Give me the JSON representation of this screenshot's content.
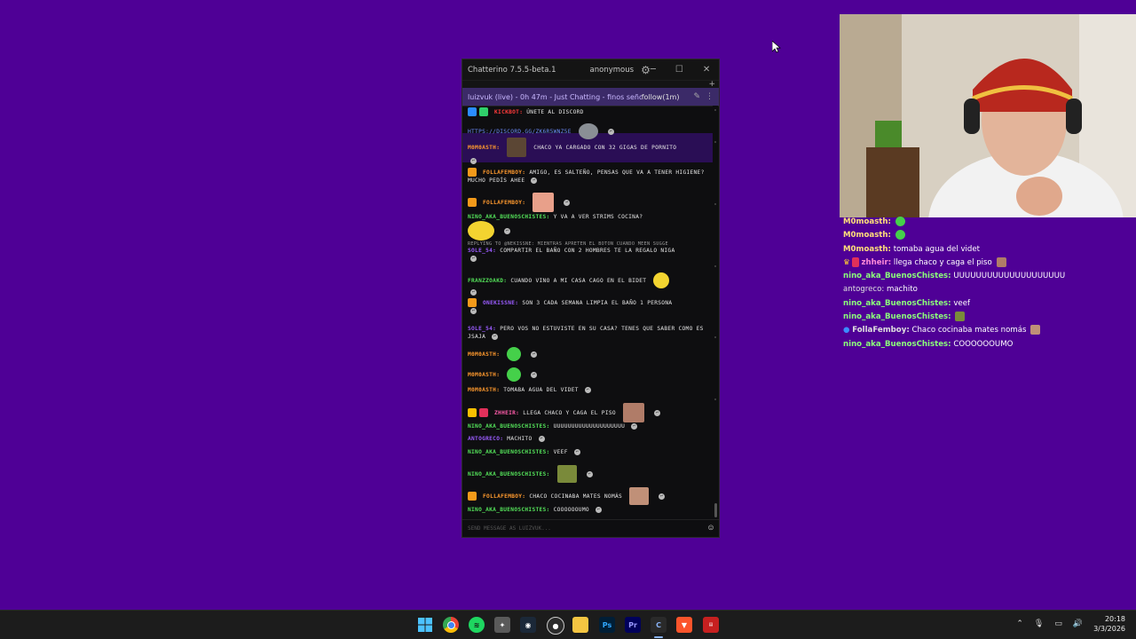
{
  "window": {
    "title": "Chatterino 7.5.5-beta.1",
    "account": "anonymous",
    "minimize": "─",
    "maximize": "☐",
    "close": "✕"
  },
  "split_header": {
    "status": "luizvuk (live) - 0h 47m - Just Chatting - finos señore",
    "follow": "follow(1m)"
  },
  "messages": [
    {
      "user": "KICKBOT:",
      "text": "ÚNETE AL DISCORD"
    },
    {
      "link": "HTTPS://DISCORD.GG/ZK6R5WNZ5E"
    },
    {
      "user": "M0M0ASTH:",
      "text": "CHACO YA CARGADO CON 32 GIGAS DE PORNITO"
    },
    {
      "user": "FOLLAFEMBOY:",
      "text": "AMIGO, ES SALTEÑO, PENSAS QUE VA A TENER HIGIENE? MUCHO PEDÍS AHEE"
    },
    {
      "user": "FOLLAFEMBOY:",
      "text": ""
    },
    {
      "user": "NINO_AKA_BUENOSCHISTES:",
      "text": "Y VA A VER STRIMS COCINA?"
    },
    {
      "reply": "REPLYING TO @NEKISSNE: MIENTRAS APRETEN EL BOTON CUANDO MEEN SUGGE"
    },
    {
      "user": "SOLE_54:",
      "text": "COMPARTIR EL BAÑO CON 2 HOMBRES TE LA REGALO NIGA"
    },
    {
      "user": "FRANZZOAKD:",
      "text": "CUANDO VINO A MI CASA CAGO EN EL BIDET"
    },
    {
      "user": "ONEKISSNE:",
      "text": "SON 3 CADA SEMANA LIMPIA EL BAÑO 1 PERSONA"
    },
    {
      "user": "SOLE_54:",
      "text": "PERO VOS NO ESTUVISTE EN SU CASA? TENES QUE SABER COMO ES JSAJA"
    },
    {
      "user": "M0M0ASTH:",
      "text": ""
    },
    {
      "user": "M0M0ASTH:",
      "text": ""
    },
    {
      "user": "M0M0ASTH:",
      "text": "TOMABA AGUA DEL VIDET"
    },
    {
      "user": "ZHHEIR:",
      "text": "LLEGA CHACO Y CAGA EL PISO"
    },
    {
      "user": "NINO_AKA_BUENOSCHISTES:",
      "text": "UUUUUUUUUUUUUUUUUUUU"
    },
    {
      "user": "ANTOGRECO:",
      "text": "MACHITO"
    },
    {
      "user": "NINO_AKA_BUENOSCHISTES:",
      "text": "VEEF"
    },
    {
      "user": "NINO_AKA_BUENOSCHISTES:",
      "text": ""
    },
    {
      "user": "FOLLAFEMBOY:",
      "text": "CHACO COCINABA MATES NOMÁS"
    },
    {
      "user": "NINO_AKA_BUENOSCHISTES:",
      "text": "COOOOOOUMO"
    }
  ],
  "input_placeholder": "SEND MESSAGE AS LUIZVUK...",
  "overlay_chat": [
    {
      "user": "M0moasth:",
      "text": ""
    },
    {
      "user": "M0moasth:",
      "text": ""
    },
    {
      "user": "M0moasth:",
      "text": "tomaba agua del videt"
    },
    {
      "user": "zhheir:",
      "text": "llega chaco y caga el piso"
    },
    {
      "user": "nino_aka_BuenosChistes:",
      "text": "UUUUUUUUUUUUUUUUUUUU"
    },
    {
      "user": "antogreco:",
      "text": "machito"
    },
    {
      "user": "nino_aka_BuenosChistes:",
      "text": "veef"
    },
    {
      "user": "nino_aka_BuenosChistes:",
      "text": ""
    },
    {
      "user": "FollaFemboy:",
      "text": "Chaco cocinaba mates nomás"
    },
    {
      "user": "nino_aka_BuenosChistes:",
      "text": "COOOOOOUMO"
    }
  ],
  "taskbar": {
    "icons": [
      "windows-start",
      "chrome",
      "spotify",
      "app-a",
      "steam",
      "obs",
      "file-explorer",
      "photoshop",
      "premiere",
      "chatterino",
      "brave",
      "mixer"
    ],
    "ps_label": "Ps",
    "pr_label": "Pr",
    "time": "20:18",
    "date": "3/3/2026"
  },
  "colors": {
    "desktop": "#4f0096",
    "header": "#3b2a68",
    "highlight": "#2a0e55"
  }
}
